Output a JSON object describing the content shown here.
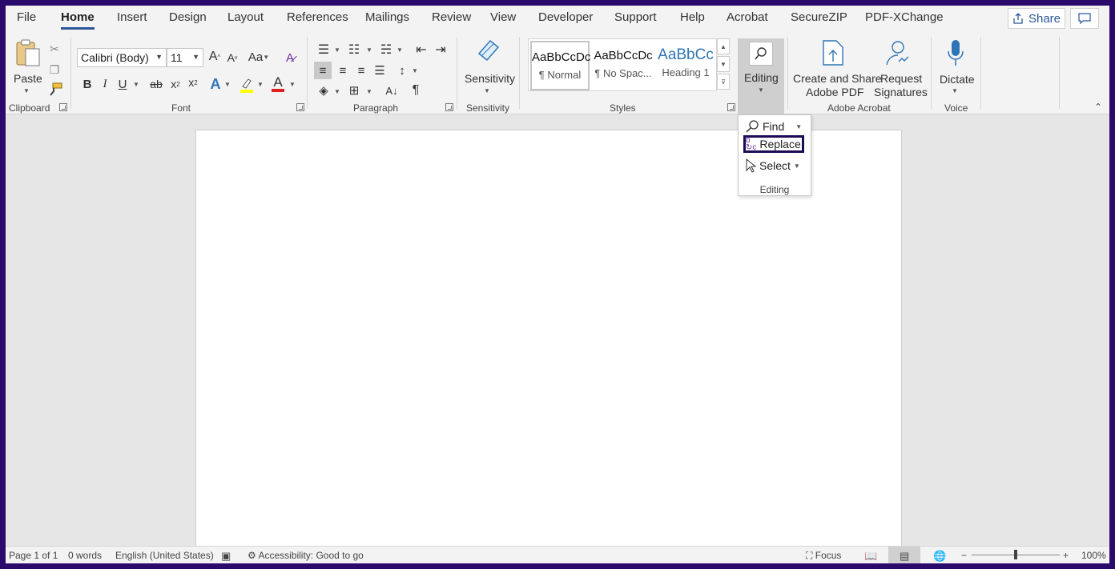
{
  "tabs": [
    "File",
    "Home",
    "Insert",
    "Design",
    "Layout",
    "References",
    "Mailings",
    "Review",
    "View",
    "Developer",
    "Support",
    "Help",
    "Acrobat",
    "SecureZIP",
    "PDF-XChange"
  ],
  "active_tab": "Home",
  "share_label": "Share",
  "ribbon": {
    "clipboard": {
      "paste": "Paste",
      "group": "Clipboard"
    },
    "font": {
      "name": "Calibri (Body)",
      "size": "11",
      "group": "Font",
      "case": "Aa"
    },
    "paragraph": {
      "group": "Paragraph"
    },
    "sensitivity": {
      "label": "Sensitivity",
      "group": "Sensitivity"
    },
    "styles": {
      "group": "Styles",
      "items": [
        {
          "sample": "AaBbCcDc",
          "name": "¶ Normal"
        },
        {
          "sample": "AaBbCcDc",
          "name": "¶ No Spac..."
        },
        {
          "sample": "AaBbCc",
          "name": "Heading 1"
        }
      ]
    },
    "editing": {
      "label": "Editing"
    },
    "acrobat": {
      "create": "Create and Share",
      "create2": "Adobe PDF",
      "request": "Request",
      "request2": "Signatures",
      "group": "Adobe Acrobat"
    },
    "voice": {
      "dictate": "Dictate",
      "group": "Voice"
    }
  },
  "dropdown": {
    "find": "Find",
    "replace": "Replace",
    "select": "Select",
    "group": "Editing"
  },
  "status": {
    "page": "Page 1 of 1",
    "words": "0 words",
    "language": "English (United States)",
    "accessibility": "Accessibility: Good to go",
    "focus": "Focus",
    "zoom": "100%"
  },
  "colors": {
    "accent": "#2b579a",
    "highlight_outline": "#1c0a55",
    "font_color": "#e02020",
    "highlight": "#ffff00"
  }
}
